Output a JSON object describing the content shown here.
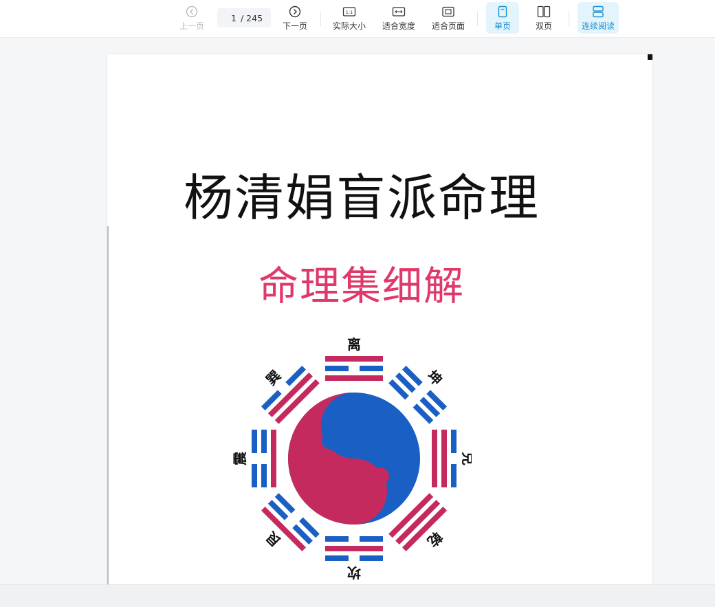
{
  "toolbar": {
    "prev_label": "上一页",
    "next_label": "下一页",
    "current_page": "1",
    "total_pages": "/ 245",
    "actual_size_label": "实际大小",
    "fit_width_label": "适合宽度",
    "fit_page_label": "适合页面",
    "single_page_label": "单页",
    "double_page_label": "双页",
    "continuous_label": "连续阅读"
  },
  "document": {
    "title": "杨清娟盲派命理",
    "subtitle": "命理集细解",
    "trigram_labels": {
      "li": "离",
      "kun": "坤",
      "dui": "兑",
      "qian": "乾",
      "kan": "坎",
      "gen": "艮",
      "zhen": "震",
      "xun": "巽"
    }
  },
  "colors": {
    "accent": "#1a8fd0",
    "active_bg": "#e3f4fc",
    "yin_red": "#c52a5e",
    "yang_blue": "#1a5fc4",
    "subtitle_pink": "#e03868"
  }
}
